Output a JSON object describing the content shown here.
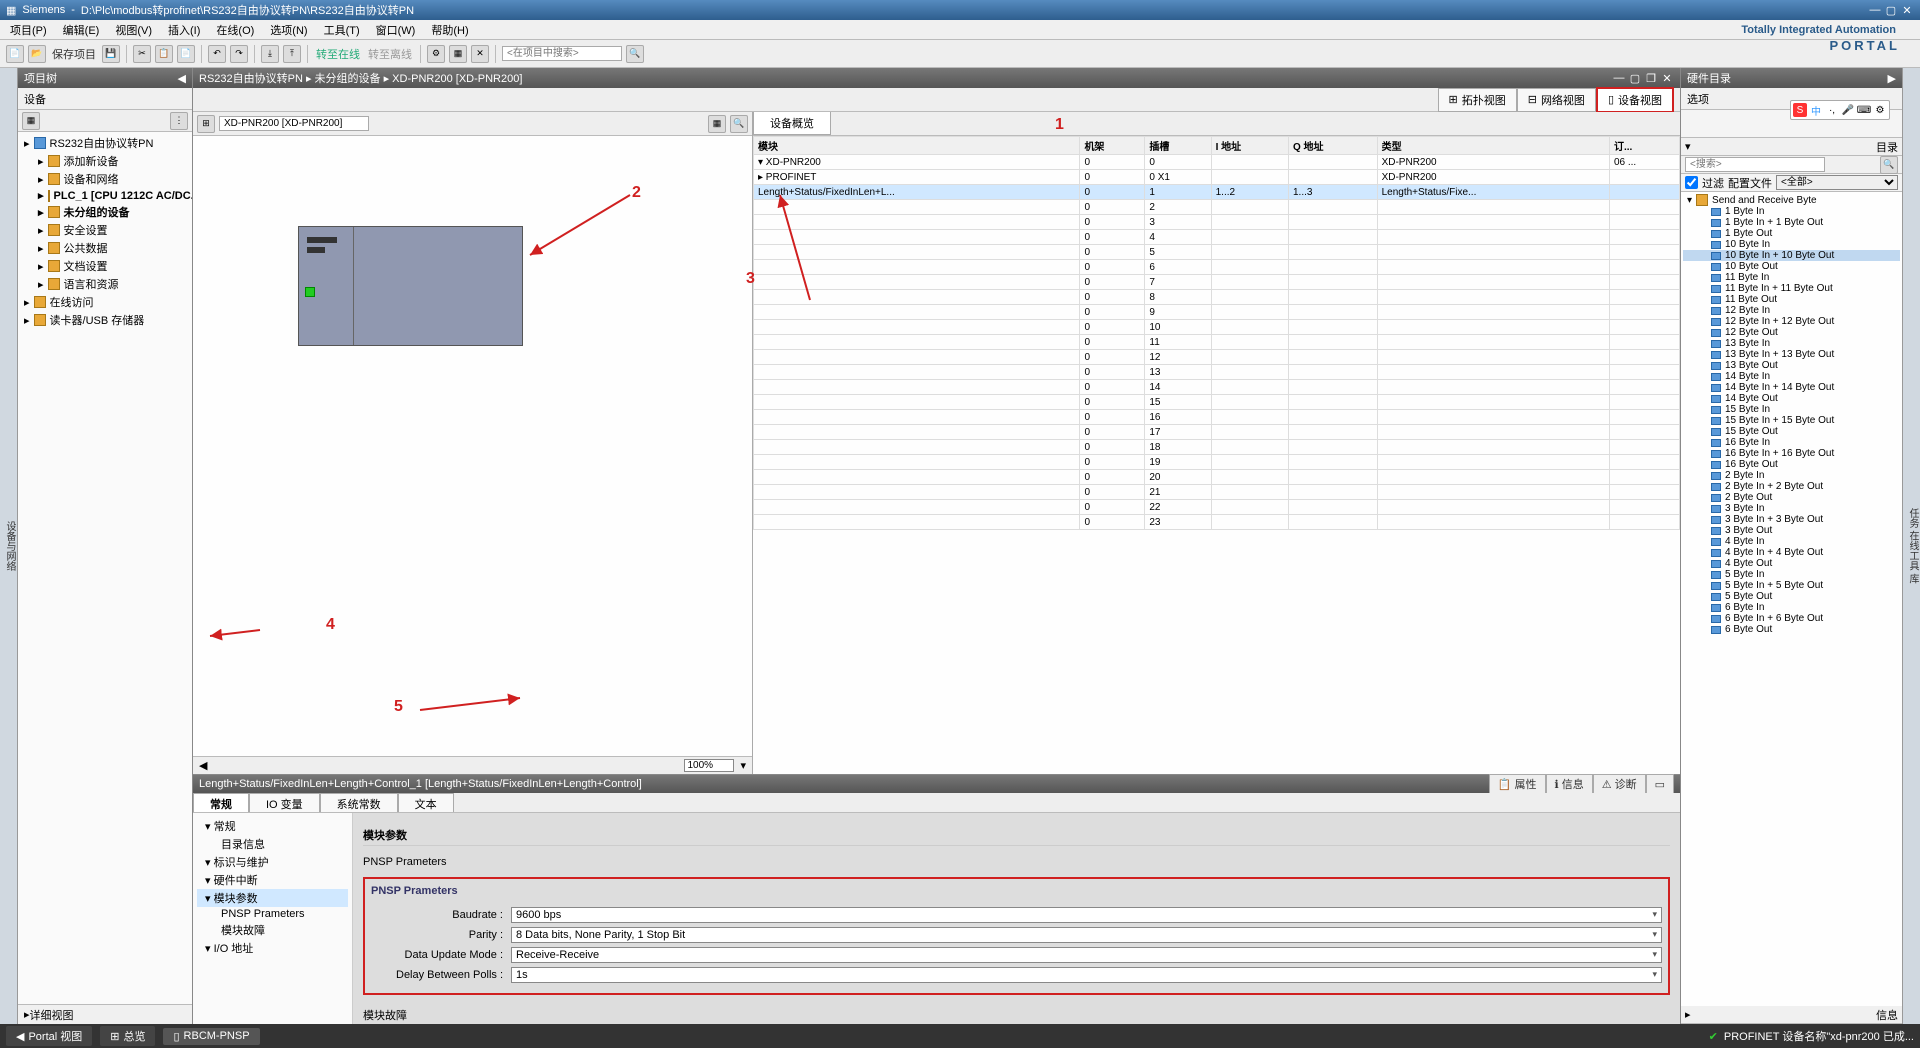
{
  "titlebar": {
    "app": "Siemens",
    "path": "D:\\Plc\\modbus转profinet\\RS232自由协议转PN\\RS232自由协议转PN"
  },
  "menubar": [
    "项目(P)",
    "编辑(E)",
    "视图(V)",
    "插入(I)",
    "在线(O)",
    "选项(N)",
    "工具(T)",
    "窗口(W)",
    "帮助(H)"
  ],
  "brand": {
    "top": "Totally Integrated Automation",
    "sub": "PORTAL"
  },
  "toolbar": {
    "save": "保存项目",
    "goonline": "转至在线",
    "gooffline": "转至离线",
    "search_ph": "<在项目中搜索>"
  },
  "leftstrip": "设备与网络",
  "projtree": {
    "title": "项目树",
    "device_tab": "设备",
    "detail": "详细视图",
    "items": [
      {
        "l": "RS232自由协议转PN",
        "i": 0,
        "b": false,
        "ic": "blue"
      },
      {
        "l": "添加新设备",
        "i": 1,
        "b": false,
        "ic": ""
      },
      {
        "l": "设备和网络",
        "i": 1,
        "b": false,
        "ic": ""
      },
      {
        "l": "PLC_1 [CPU 1212C AC/DC...",
        "i": 1,
        "b": true,
        "ic": ""
      },
      {
        "l": "未分组的设备",
        "i": 1,
        "b": true,
        "ic": ""
      },
      {
        "l": "安全设置",
        "i": 1,
        "b": false,
        "ic": ""
      },
      {
        "l": "公共数据",
        "i": 1,
        "b": false,
        "ic": ""
      },
      {
        "l": "文档设置",
        "i": 1,
        "b": false,
        "ic": ""
      },
      {
        "l": "语言和资源",
        "i": 1,
        "b": false,
        "ic": ""
      },
      {
        "l": "在线访问",
        "i": 0,
        "b": false,
        "ic": ""
      },
      {
        "l": "读卡器/USB 存储器",
        "i": 0,
        "b": false,
        "ic": ""
      }
    ]
  },
  "workspace": {
    "breadcrumb": "RS232自由协议转PN  ▸  未分组的设备  ▸  XD-PNR200 [XD-PNR200]",
    "view_tabs": {
      "topo": "拓扑视图",
      "net": "网络视图",
      "dev": "设备视图"
    },
    "canvas_drop": "XD-PNR200 [XD-PNR200]",
    "zoom": "100%"
  },
  "overview": {
    "tab": "设备概览",
    "cols": [
      "模块",
      "机架",
      "插槽",
      "I 地址",
      "Q 地址",
      "类型",
      "订..."
    ],
    "rows": [
      {
        "mod": "▾  XD-PNR200",
        "rack": "0",
        "slot": "0",
        "ia": "",
        "qa": "",
        "type": "XD-PNR200",
        "ord": "06 ..."
      },
      {
        "mod": "   ▸ PROFINET",
        "rack": "0",
        "slot": "0 X1",
        "ia": "",
        "qa": "",
        "type": "XD-PNR200",
        "ord": ""
      },
      {
        "mod": "   Length+Status/FixedInLen+L...",
        "rack": "0",
        "slot": "1",
        "ia": "1...2",
        "qa": "1...3",
        "type": "Length+Status/Fixe...",
        "ord": "",
        "sel": true
      },
      {
        "mod": "",
        "rack": "0",
        "slot": "2",
        "ia": "",
        "qa": "",
        "type": "",
        "ord": ""
      },
      {
        "mod": "",
        "rack": "0",
        "slot": "3",
        "ia": "",
        "qa": "",
        "type": "",
        "ord": ""
      },
      {
        "mod": "",
        "rack": "0",
        "slot": "4",
        "ia": "",
        "qa": "",
        "type": "",
        "ord": ""
      },
      {
        "mod": "",
        "rack": "0",
        "slot": "5",
        "ia": "",
        "qa": "",
        "type": "",
        "ord": ""
      },
      {
        "mod": "",
        "rack": "0",
        "slot": "6",
        "ia": "",
        "qa": "",
        "type": "",
        "ord": ""
      },
      {
        "mod": "",
        "rack": "0",
        "slot": "7",
        "ia": "",
        "qa": "",
        "type": "",
        "ord": ""
      },
      {
        "mod": "",
        "rack": "0",
        "slot": "8",
        "ia": "",
        "qa": "",
        "type": "",
        "ord": ""
      },
      {
        "mod": "",
        "rack": "0",
        "slot": "9",
        "ia": "",
        "qa": "",
        "type": "",
        "ord": ""
      },
      {
        "mod": "",
        "rack": "0",
        "slot": "10",
        "ia": "",
        "qa": "",
        "type": "",
        "ord": ""
      },
      {
        "mod": "",
        "rack": "0",
        "slot": "11",
        "ia": "",
        "qa": "",
        "type": "",
        "ord": ""
      },
      {
        "mod": "",
        "rack": "0",
        "slot": "12",
        "ia": "",
        "qa": "",
        "type": "",
        "ord": ""
      },
      {
        "mod": "",
        "rack": "0",
        "slot": "13",
        "ia": "",
        "qa": "",
        "type": "",
        "ord": ""
      },
      {
        "mod": "",
        "rack": "0",
        "slot": "14",
        "ia": "",
        "qa": "",
        "type": "",
        "ord": ""
      },
      {
        "mod": "",
        "rack": "0",
        "slot": "15",
        "ia": "",
        "qa": "",
        "type": "",
        "ord": ""
      },
      {
        "mod": "",
        "rack": "0",
        "slot": "16",
        "ia": "",
        "qa": "",
        "type": "",
        "ord": ""
      },
      {
        "mod": "",
        "rack": "0",
        "slot": "17",
        "ia": "",
        "qa": "",
        "type": "",
        "ord": ""
      },
      {
        "mod": "",
        "rack": "0",
        "slot": "18",
        "ia": "",
        "qa": "",
        "type": "",
        "ord": ""
      },
      {
        "mod": "",
        "rack": "0",
        "slot": "19",
        "ia": "",
        "qa": "",
        "type": "",
        "ord": ""
      },
      {
        "mod": "",
        "rack": "0",
        "slot": "20",
        "ia": "",
        "qa": "",
        "type": "",
        "ord": ""
      },
      {
        "mod": "",
        "rack": "0",
        "slot": "21",
        "ia": "",
        "qa": "",
        "type": "",
        "ord": ""
      },
      {
        "mod": "",
        "rack": "0",
        "slot": "22",
        "ia": "",
        "qa": "",
        "type": "",
        "ord": ""
      },
      {
        "mod": "",
        "rack": "0",
        "slot": "23",
        "ia": "",
        "qa": "",
        "type": "",
        "ord": ""
      }
    ]
  },
  "prop": {
    "title": "Length+Status/FixedInLen+Length+Control_1 [Length+Status/FixedInLen+Length+Control]",
    "rtabs": {
      "props": "属性",
      "info": "信息",
      "diag": "诊断"
    },
    "tabs": [
      "常规",
      "IO 变量",
      "系统常数",
      "文本"
    ],
    "nav": [
      {
        "l": "常规",
        "i": 0
      },
      {
        "l": "目录信息",
        "i": 1
      },
      {
        "l": "标识与维护",
        "i": 0
      },
      {
        "l": "硬件中断",
        "i": 0
      },
      {
        "l": "模块参数",
        "i": 0,
        "sel": true
      },
      {
        "l": "PNSP Prameters",
        "i": 1
      },
      {
        "l": "模块故障",
        "i": 1
      },
      {
        "l": "I/O 地址",
        "i": 0
      }
    ],
    "form": {
      "head": "模块参数",
      "sub": "PNSP Prameters",
      "group": "PNSP Prameters",
      "fields": [
        {
          "label": "Baudrate :",
          "value": "9600 bps"
        },
        {
          "label": "Parity :",
          "value": "8 Data bits, None Parity, 1 Stop Bit"
        },
        {
          "label": "Data Update Mode :",
          "value": "Receive-Receive"
        },
        {
          "label": "Delay Between Polls :",
          "value": "1s"
        }
      ],
      "foot": "模块故障"
    }
  },
  "catalog": {
    "title": "硬件目录",
    "options": "选项",
    "dir": "目录",
    "search_ph": "<搜索>",
    "filter": "过滤",
    "profile_l": "配置文件",
    "profile": "<全部>",
    "root": "Send and Receive Byte",
    "items": [
      "1 Byte In",
      "1 Byte In + 1 Byte Out",
      "1 Byte Out",
      "10 Byte In",
      "10 Byte In + 10 Byte Out",
      "10 Byte Out",
      "11 Byte In",
      "11 Byte In + 11 Byte Out",
      "11 Byte Out",
      "12 Byte In",
      "12 Byte In + 12 Byte Out",
      "12 Byte Out",
      "13 Byte In",
      "13 Byte In + 13 Byte Out",
      "13 Byte Out",
      "14 Byte In",
      "14 Byte In + 14 Byte Out",
      "14 Byte Out",
      "15 Byte In",
      "15 Byte In + 15 Byte Out",
      "15 Byte Out",
      "16 Byte In",
      "16 Byte In + 16 Byte Out",
      "16 Byte Out",
      "2 Byte In",
      "2 Byte In + 2 Byte Out",
      "2 Byte Out",
      "3 Byte In",
      "3 Byte In + 3 Byte Out",
      "3 Byte Out",
      "4 Byte In",
      "4 Byte In + 4 Byte Out",
      "4 Byte Out",
      "5 Byte In",
      "5 Byte In + 5 Byte Out",
      "5 Byte Out",
      "6 Byte In",
      "6 Byte In + 6 Byte Out",
      "6 Byte Out"
    ],
    "sel_idx": 4,
    "info": "信息"
  },
  "rightstrip": [
    "任务",
    "在线工具",
    "库"
  ],
  "statusbar": {
    "portal": "Portal 视图",
    "overview": "总览",
    "module": "RBCM-PNSP",
    "right": "PROFINET 设备名称\"xd-pnr200 已成..."
  },
  "annos": {
    "n1": "1",
    "n2": "2",
    "n3": "3",
    "n4": "4",
    "n5": "5"
  },
  "ime": "中"
}
